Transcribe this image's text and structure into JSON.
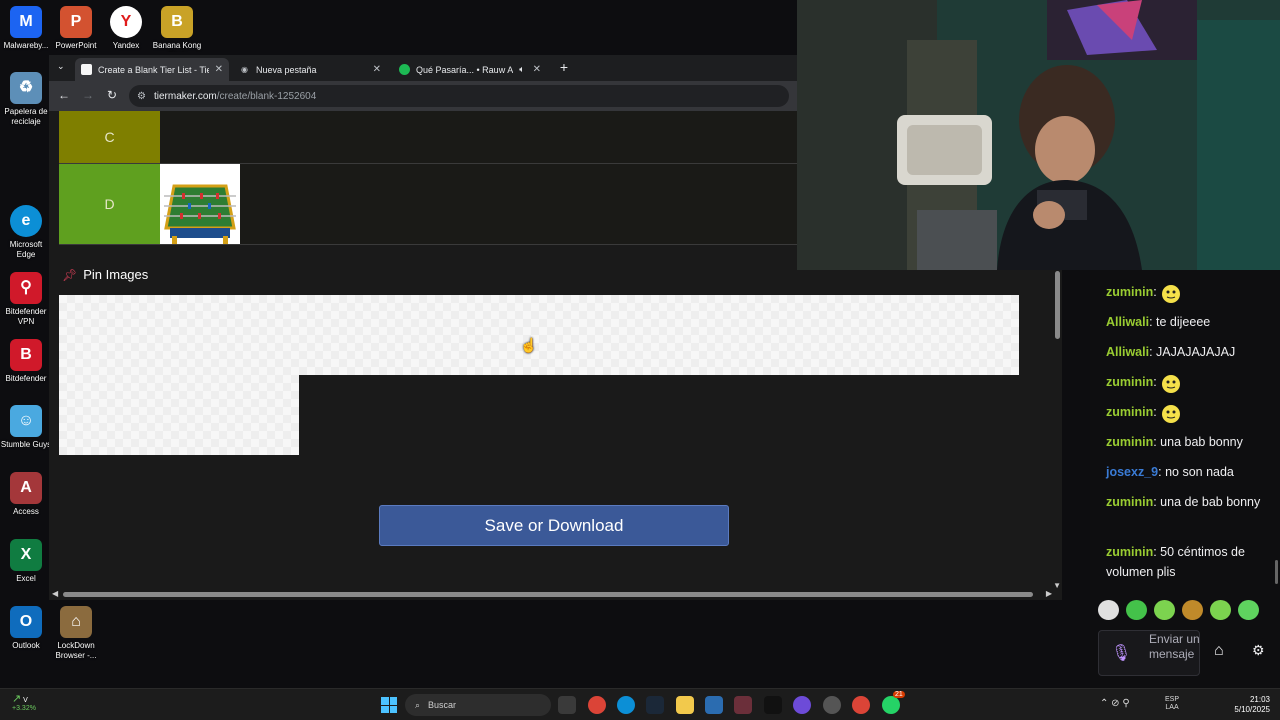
{
  "desktop_icons": [
    {
      "label": "Malwareby...",
      "color": "#1c64f2",
      "glyph": "M"
    },
    {
      "label": "PowerPoint",
      "color": "#d35230",
      "glyph": "P"
    },
    {
      "label": "Yandex",
      "color": "#ffffff",
      "glyph": "Y"
    },
    {
      "label": "Banana Kong Blast",
      "color": "#c9a227",
      "glyph": "B"
    },
    {
      "label": "Papelera de reciclaje",
      "color": "#5d8fb8",
      "glyph": "♻"
    },
    {
      "label": "Microsoft Edge",
      "color": "#0c8fd6",
      "glyph": "e"
    },
    {
      "label": "Bitdefender VPN",
      "color": "#d0192a",
      "glyph": "⚲"
    },
    {
      "label": "Bitdefender",
      "color": "#d0192a",
      "glyph": "B"
    },
    {
      "label": "Stumble Guys",
      "color": "#4aa9e0",
      "glyph": "☺"
    },
    {
      "label": "Access",
      "color": "#a4373a",
      "glyph": "A"
    },
    {
      "label": "Excel",
      "color": "#107c41",
      "glyph": "X"
    },
    {
      "label": "Outlook",
      "color": "#0f6cbd",
      "glyph": "O"
    },
    {
      "label": "LockDown Browser -...",
      "color": "#8b6b3e",
      "glyph": "⌂"
    }
  ],
  "browser": {
    "tabs": [
      {
        "title": "Create a Blank Tier List - TierM",
        "icon": "tiermaker-icon",
        "icon_color": "#f7f7f7"
      },
      {
        "title": "Nueva pestaña",
        "icon": "chrome-icon",
        "icon_color": "#bdc1c6"
      },
      {
        "title": "Qué Pasaría... • Rauw Alejan",
        "icon": "spotify-icon",
        "icon_color": "#1db954"
      }
    ],
    "url_domain": "tiermaker.com",
    "url_path": "/create/blank-1252604"
  },
  "tierlist": {
    "rows": [
      {
        "label": "C",
        "color": "#7f7f00"
      },
      {
        "label": "D",
        "color": "#5fa01f"
      }
    ],
    "pin_header": "Pin Images",
    "save_button": "Save or Download"
  },
  "chat": {
    "messages": [
      {
        "user": "zuminin",
        "user_color": "#9acd32",
        "text": "",
        "emote": true
      },
      {
        "user": "Alliwali",
        "user_color": "#9acd32",
        "text": "te dijeeee",
        "emote": false
      },
      {
        "user": "Alliwali",
        "user_color": "#9acd32",
        "text": "JAJAJAJAJAJ",
        "emote": false
      },
      {
        "user": "zuminin",
        "user_color": "#9acd32",
        "text": "",
        "emote": true
      },
      {
        "user": "zuminin",
        "user_color": "#9acd32",
        "text": "",
        "emote": true
      },
      {
        "user": "zuminin",
        "user_color": "#9acd32",
        "text": "una bab bonny",
        "emote": false
      },
      {
        "user": "josexz_9",
        "user_color": "#3a7bd5",
        "text": "no son nada",
        "emote": false
      },
      {
        "user": "zuminin",
        "user_color": "#9acd32",
        "text": "una de bab bonny",
        "emote": false
      },
      {
        "user": "zuminin",
        "user_color": "#9acd32",
        "text": "50 céntimos de volumen plis",
        "emote": false
      }
    ],
    "input_placeholder": "Enviar un mensaje"
  },
  "taskbar": {
    "stock_label": "V",
    "stock_change": "+3.32%",
    "search_placeholder": "Buscar",
    "lang_top": "ESP",
    "lang_bottom": "LAA",
    "time": "21:03",
    "date": "5/10/2025",
    "notification_count": "21"
  }
}
